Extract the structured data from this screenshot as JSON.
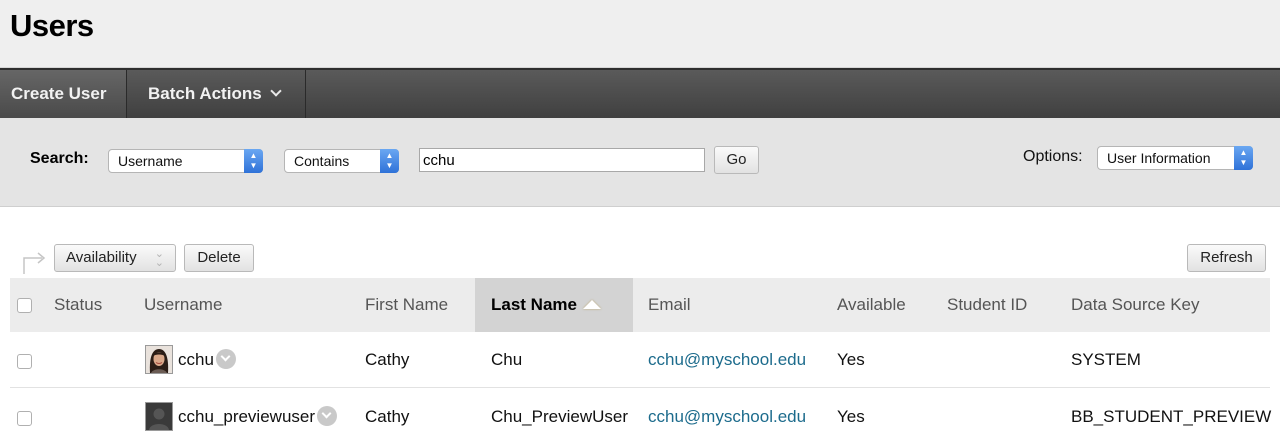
{
  "page": {
    "title": "Users"
  },
  "action_bar": {
    "create_user": "Create User",
    "batch_actions": "Batch Actions"
  },
  "search": {
    "label": "Search:",
    "field": "Username",
    "operator": "Contains",
    "value": "cchu",
    "go": "Go",
    "options_label": "Options:",
    "options_value": "User Information"
  },
  "list_actions": {
    "availability": "Availability",
    "delete": "Delete",
    "refresh": "Refresh"
  },
  "table": {
    "columns": {
      "status": "Status",
      "username": "Username",
      "first_name": "First Name",
      "last_name": "Last Name",
      "email": "Email",
      "available": "Available",
      "student_id": "Student ID",
      "data_source_key": "Data Source Key"
    },
    "sorted_column": "Last Name",
    "sort_direction": "ascending",
    "rows": [
      {
        "username": "cchu",
        "first_name": "Cathy",
        "last_name": "Chu",
        "email": "cchu@myschool.edu",
        "available": "Yes",
        "student_id": "",
        "data_source_key": "SYSTEM",
        "avatar": "photo-avatar"
      },
      {
        "username": "cchu_previewuser",
        "first_name": "Cathy",
        "last_name": "Chu_PreviewUser",
        "email": "cchu@myschool.edu",
        "available": "Yes",
        "student_id": "",
        "data_source_key": "BB_STUDENT_PREVIEW",
        "avatar": "default-silhouette-avatar"
      }
    ]
  },
  "colors": {
    "link": "#1c6b8c",
    "select_accent": "#2f72d8",
    "action_bar": "#4a4a4a"
  }
}
